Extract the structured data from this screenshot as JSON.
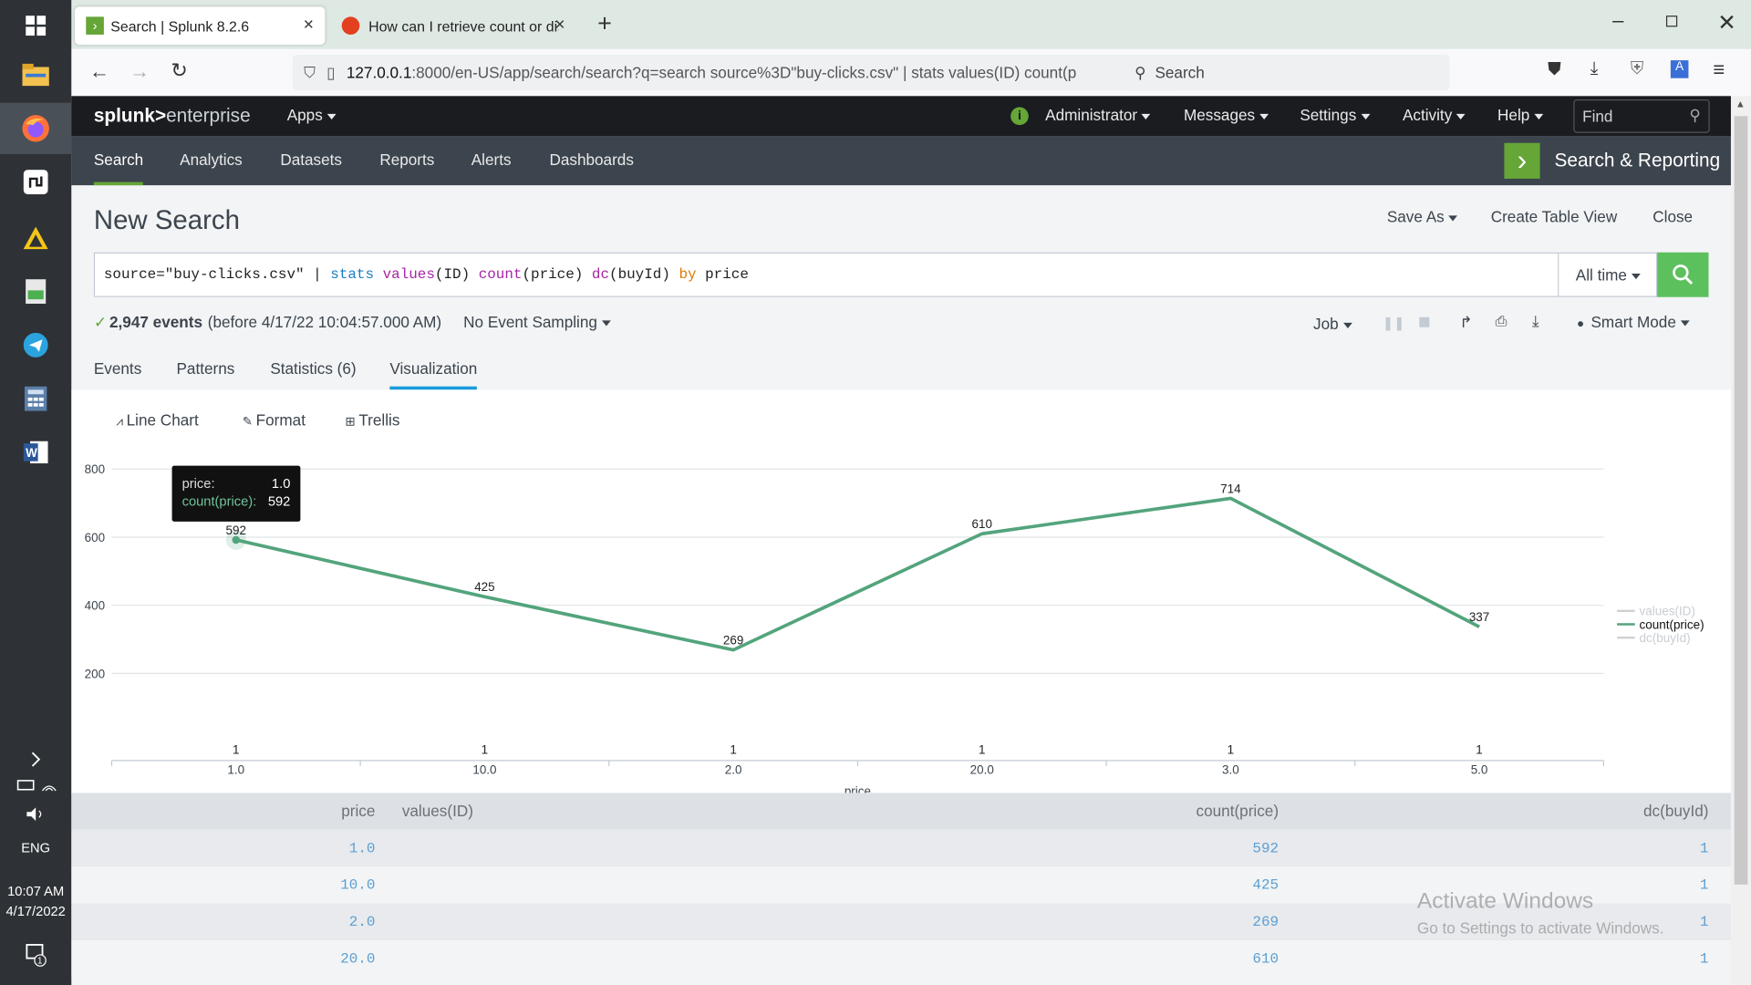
{
  "os": {
    "time": "10:07 AM",
    "date": "4/17/2022",
    "language": "ENG",
    "notification_count": "1"
  },
  "browser": {
    "tabs": [
      {
        "label": "Search | Splunk 8.2.6",
        "active": true
      },
      {
        "label": "How can I retrieve count or dist",
        "active": false
      }
    ],
    "url_host": "127.0.0.1",
    "url_rest": ":8000/en-US/app/search/search?q=search source%3D\"buy-clicks.csv\" | stats values(ID) count(p",
    "search_placeholder": "Search"
  },
  "splunk": {
    "logo_splunk": "splunk>",
    "logo_enterprise": "enterprise",
    "apps": "Apps",
    "admin": "Administrator",
    "messages": "Messages",
    "settings": "Settings",
    "activity": "Activity",
    "help": "Help",
    "find": "Find",
    "nav": [
      "Search",
      "Analytics",
      "Datasets",
      "Reports",
      "Alerts",
      "Dashboards"
    ],
    "app_title": "Search & Reporting",
    "page_title": "New Search",
    "save_as": "Save As",
    "create_table_view": "Create Table View",
    "close": "Close",
    "query": {
      "p1": "source=\"buy-clicks.csv\" | ",
      "stats": "stats",
      "values": "values",
      "p2": "(ID) ",
      "count": "count",
      "p3": "(price) ",
      "dc": "dc",
      "p4": "(buyId) ",
      "by": "by",
      "p5": " price"
    },
    "time_range": "All time",
    "events_count": "2,947 events",
    "events_time": "(before 4/17/22 10:04:57.000 AM)",
    "sampling": "No Event Sampling",
    "job": "Job",
    "smart_mode": "Smart Mode",
    "result_tabs": [
      "Events",
      "Patterns",
      "Statistics (6)",
      "Visualization"
    ],
    "vis_menu": {
      "line_chart": "Line Chart",
      "format": "Format",
      "trellis": "Trellis"
    },
    "tooltip": {
      "k1": "price:",
      "v1": "1.0",
      "k2": "count(price):",
      "v2": "592"
    },
    "table": {
      "headers": [
        "price",
        "values(ID)",
        "count(price)",
        "dc(buyId)"
      ],
      "rows": [
        [
          "1.0",
          "",
          "592",
          "1"
        ],
        [
          "10.0",
          "",
          "425",
          "1"
        ],
        [
          "2.0",
          "",
          "269",
          "1"
        ],
        [
          "20.0",
          "",
          "610",
          "1"
        ]
      ]
    },
    "watermark": {
      "title": "Activate Windows",
      "subtitle": "Go to Settings to activate Windows."
    }
  },
  "chart_data": {
    "type": "line",
    "categories": [
      "1.0",
      "10.0",
      "2.0",
      "20.0",
      "3.0",
      "5.0"
    ],
    "series": [
      {
        "name": "values(ID)",
        "values": [
          null,
          null,
          null,
          null,
          null,
          null
        ],
        "color": "#d0d0d0"
      },
      {
        "name": "count(price)",
        "values": [
          592,
          425,
          269,
          610,
          714,
          337
        ],
        "color": "#53a47c"
      },
      {
        "name": "dc(buyId)",
        "values": [
          1,
          1,
          1,
          1,
          1,
          1
        ],
        "color": "#d0d0d0"
      }
    ],
    "xlabel": "price",
    "ylabel": "",
    "yticks": [
      200,
      400,
      600,
      800
    ],
    "ylim": [
      0,
      800
    ],
    "grid": true,
    "legend": "right",
    "highlighted_point": "1.0"
  }
}
